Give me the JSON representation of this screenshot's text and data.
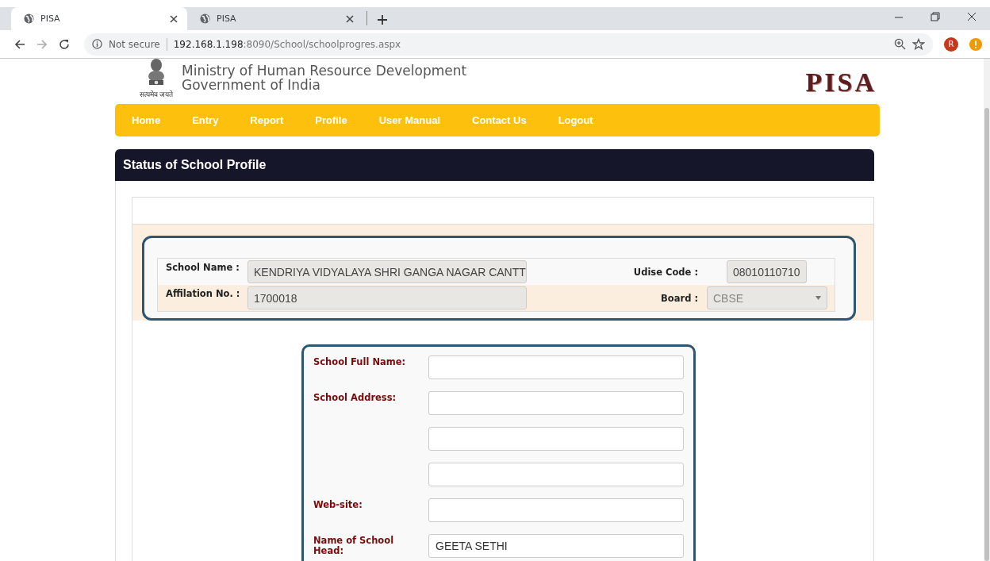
{
  "browser": {
    "tabs": [
      {
        "title": "PISA",
        "selected": true
      },
      {
        "title": "PISA",
        "selected": false
      }
    ],
    "address": {
      "security": "Not secure",
      "host": "192.168.1.198",
      "path": ":8090/School/schoolprogres.aspx"
    },
    "profile_initial": "R"
  },
  "header": {
    "lines": [
      "Ministry of Human Resource Development",
      "Government of India"
    ],
    "emblem_caption": "सत्यमेव जयते",
    "logo": "PISA"
  },
  "nav": [
    "Home",
    "Entry",
    "Report",
    "Profile",
    "User Manual",
    "Contact Us",
    "Logout"
  ],
  "panel": {
    "title": "Status of School Profile"
  },
  "school_info": [
    {
      "fields": [
        {
          "kind": "text",
          "label": "School Name :",
          "value": "KENDRIYA VIDYALAYA SHRI GANGA NAGAR CANTT"
        },
        {
          "kind": "text",
          "label": "Udise Code :",
          "value": "08010110710"
        }
      ]
    },
    {
      "fields": [
        {
          "kind": "text",
          "label": "Affilation No. :",
          "value": "1700018"
        },
        {
          "kind": "select",
          "label": "Board :",
          "value": "CBSE"
        }
      ]
    }
  ],
  "form": [
    {
      "kind": "field",
      "label": "School Full Name:"
    },
    {
      "kind": "field",
      "label": "School Address:"
    },
    {
      "kind": "continuation"
    },
    {
      "kind": "continuation"
    },
    {
      "kind": "field",
      "label": "Web-site:"
    },
    {
      "kind": "field",
      "label": "Name of School Head:",
      "value": "GEETA SETHI"
    }
  ]
}
